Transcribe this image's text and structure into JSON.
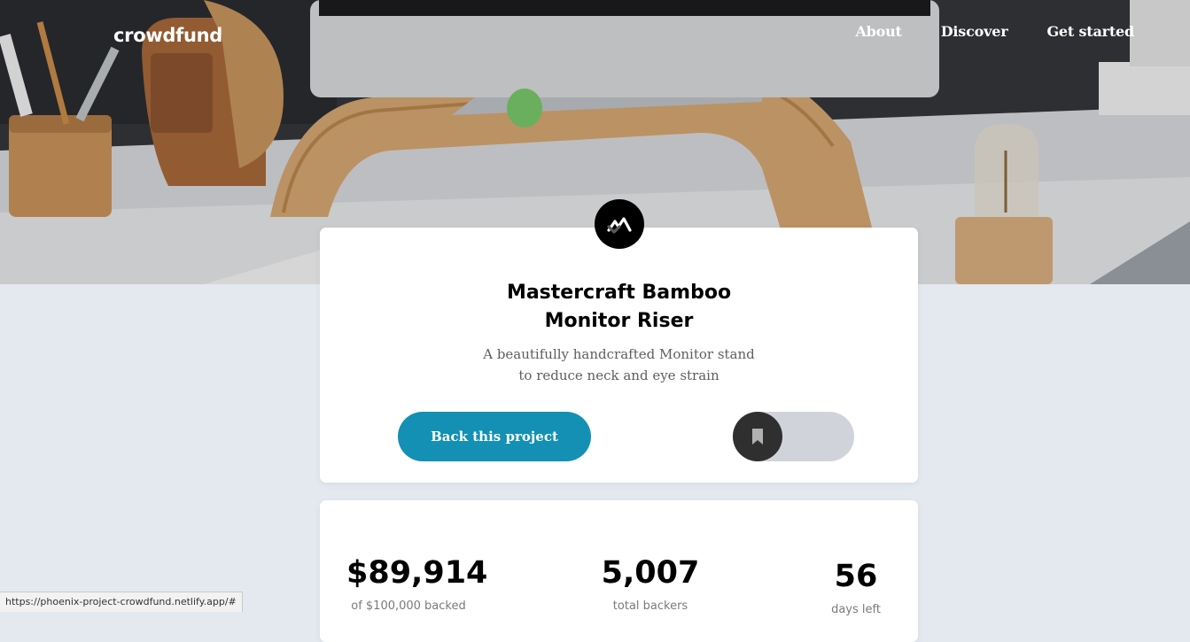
{
  "header": {
    "logo": "crowdfund",
    "nav": [
      "About",
      "Discover",
      "Get started"
    ]
  },
  "project": {
    "title": "Mastercraft Bamboo Monitor Riser",
    "description": "A beautifully handcrafted Monitor stand to reduce neck and eye strain",
    "back_label": "Back this project",
    "bookmark_state": "unbookmarked"
  },
  "stats": {
    "backed_amount": "$89,914",
    "backed_label": "of $100,000 backed",
    "backers_count": "5,007",
    "backers_label": "total backers",
    "days_count": "56",
    "days_label": "days left"
  },
  "status_bar": {
    "url": "https://phoenix-project-crowdfund.netlify.app/#"
  },
  "colors": {
    "primary": "#1390b4",
    "background": "#e4e8ef",
    "dark": "#2f2f2f"
  },
  "icons": [
    "mastercraft-logo-icon",
    "bookmark-icon"
  ]
}
